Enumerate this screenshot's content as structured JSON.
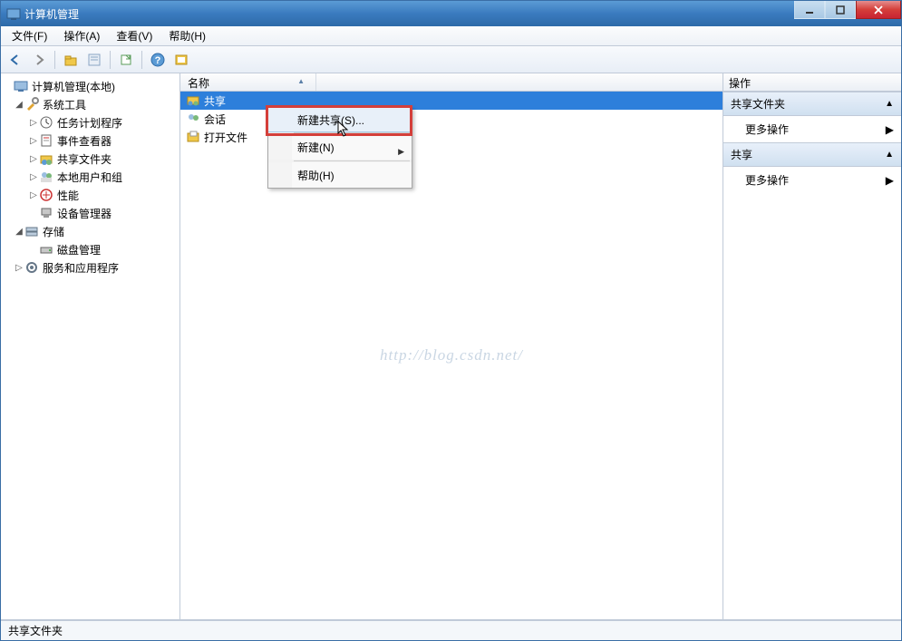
{
  "titlebar": {
    "title": "计算机管理"
  },
  "menubar": {
    "items": [
      "文件(F)",
      "操作(A)",
      "查看(V)",
      "帮助(H)"
    ]
  },
  "tree": {
    "root": "计算机管理(本地)",
    "system_tools": "系统工具",
    "task_scheduler": "任务计划程序",
    "event_viewer": "事件查看器",
    "shared_folders": "共享文件夹",
    "local_users": "本地用户和组",
    "performance": "性能",
    "device_manager": "设备管理器",
    "storage": "存储",
    "disk_mgmt": "磁盘管理",
    "services_apps": "服务和应用程序"
  },
  "list": {
    "col_name": "名称",
    "rows": [
      "共享",
      "会话",
      "打开文件"
    ]
  },
  "context_menu": {
    "new_share": "新建共享(S)...",
    "new": "新建(N)",
    "help": "帮助(H)"
  },
  "action_pane": {
    "title": "操作",
    "section1": "共享文件夹",
    "section2": "共享",
    "more_actions": "更多操作"
  },
  "statusbar": {
    "text": "共享文件夹"
  },
  "watermark": "http://blog.csdn.net/"
}
